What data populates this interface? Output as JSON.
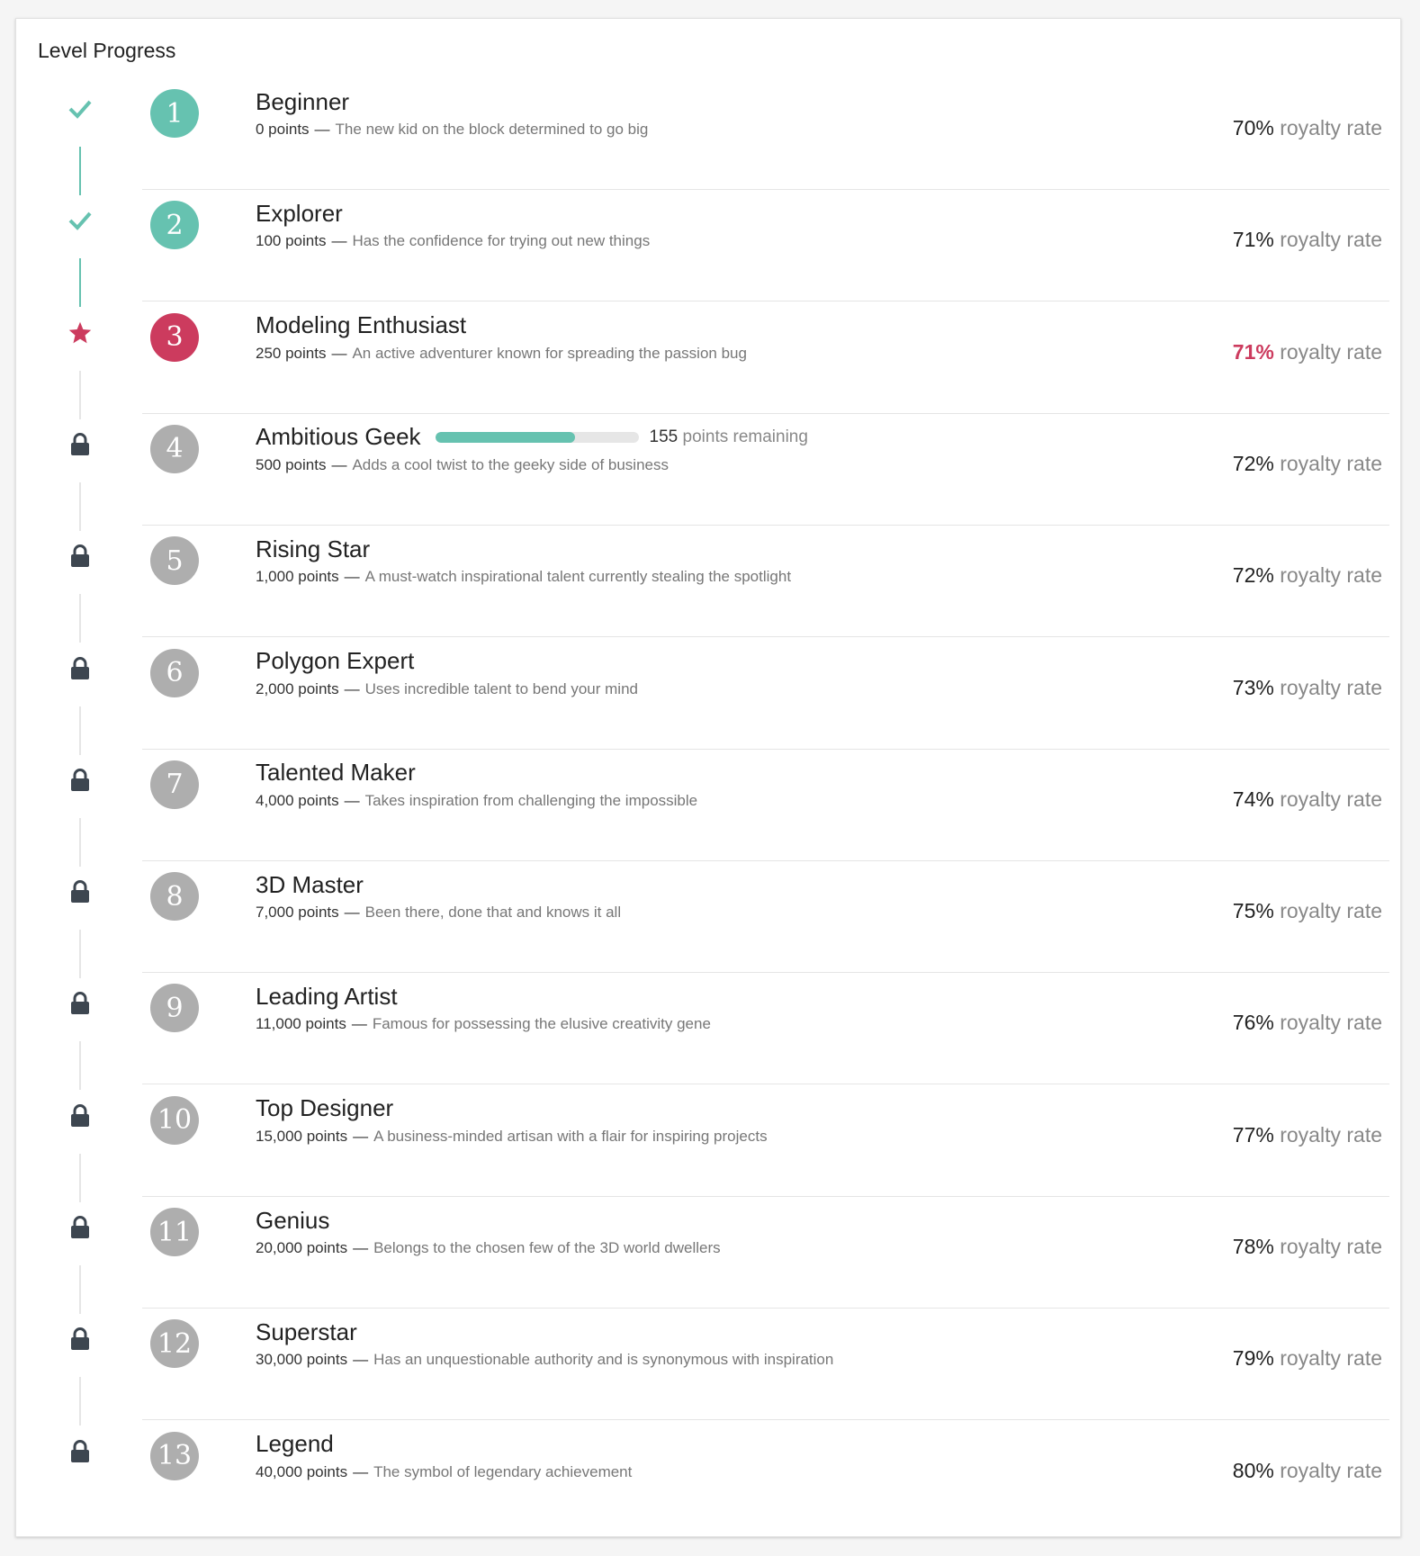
{
  "card": {
    "title": "Level Progress"
  },
  "royalty_suffix": "royalty rate",
  "colors": {
    "done": "#66c2b0",
    "current": "#cc3b5e",
    "locked": "#aeaeae",
    "lock_icon": "#3d4650"
  },
  "levels": [
    {
      "number": "1",
      "name": "Beginner",
      "points": "0 points",
      "description": "The new kid on the block determined to go big",
      "rate": "70%",
      "status": "done",
      "status_icon": "check-icon"
    },
    {
      "number": "2",
      "name": "Explorer",
      "points": "100 points",
      "description": "Has the confidence for trying out new things",
      "rate": "71%",
      "status": "done",
      "status_icon": "check-icon"
    },
    {
      "number": "3",
      "name": "Modeling Enthusiast",
      "points": "250 points",
      "description": "An active adventurer known for spreading the passion bug",
      "rate": "71%",
      "status": "current",
      "status_icon": "star-icon"
    },
    {
      "number": "4",
      "name": "Ambitious Geek",
      "points": "500 points",
      "description": "Adds a cool twist to the geeky side of business",
      "rate": "72%",
      "status": "locked",
      "status_icon": "lock-icon",
      "progress": {
        "fraction": 0.69,
        "remaining_value": "155",
        "remaining_label": "points remaining"
      }
    },
    {
      "number": "5",
      "name": "Rising Star",
      "points": "1,000 points",
      "description": "A must-watch inspirational talent currently stealing the spotlight",
      "rate": "72%",
      "status": "locked",
      "status_icon": "lock-icon"
    },
    {
      "number": "6",
      "name": "Polygon Expert",
      "points": "2,000 points",
      "description": "Uses incredible talent to bend your mind",
      "rate": "73%",
      "status": "locked",
      "status_icon": "lock-icon"
    },
    {
      "number": "7",
      "name": "Talented Maker",
      "points": "4,000 points",
      "description": "Takes inspiration from challenging the impossible",
      "rate": "74%",
      "status": "locked",
      "status_icon": "lock-icon"
    },
    {
      "number": "8",
      "name": "3D Master",
      "points": "7,000 points",
      "description": "Been there, done that and knows it all",
      "rate": "75%",
      "status": "locked",
      "status_icon": "lock-icon"
    },
    {
      "number": "9",
      "name": "Leading Artist",
      "points": "11,000 points",
      "description": "Famous for possessing the elusive creativity gene",
      "rate": "76%",
      "status": "locked",
      "status_icon": "lock-icon"
    },
    {
      "number": "10",
      "name": "Top Designer",
      "points": "15,000 points",
      "description": "A business-minded artisan with a flair for inspiring projects",
      "rate": "77%",
      "status": "locked",
      "status_icon": "lock-icon"
    },
    {
      "number": "11",
      "name": "Genius",
      "points": "20,000 points",
      "description": "Belongs to the chosen few of the 3D world dwellers",
      "rate": "78%",
      "status": "locked",
      "status_icon": "lock-icon"
    },
    {
      "number": "12",
      "name": "Superstar",
      "points": "30,000 points",
      "description": "Has an unquestionable authority and is synonymous with inspiration",
      "rate": "79%",
      "status": "locked",
      "status_icon": "lock-icon"
    },
    {
      "number": "13",
      "name": "Legend",
      "points": "40,000 points",
      "description": "The symbol of legendary achievement",
      "rate": "80%",
      "status": "locked",
      "status_icon": "lock-icon"
    }
  ]
}
